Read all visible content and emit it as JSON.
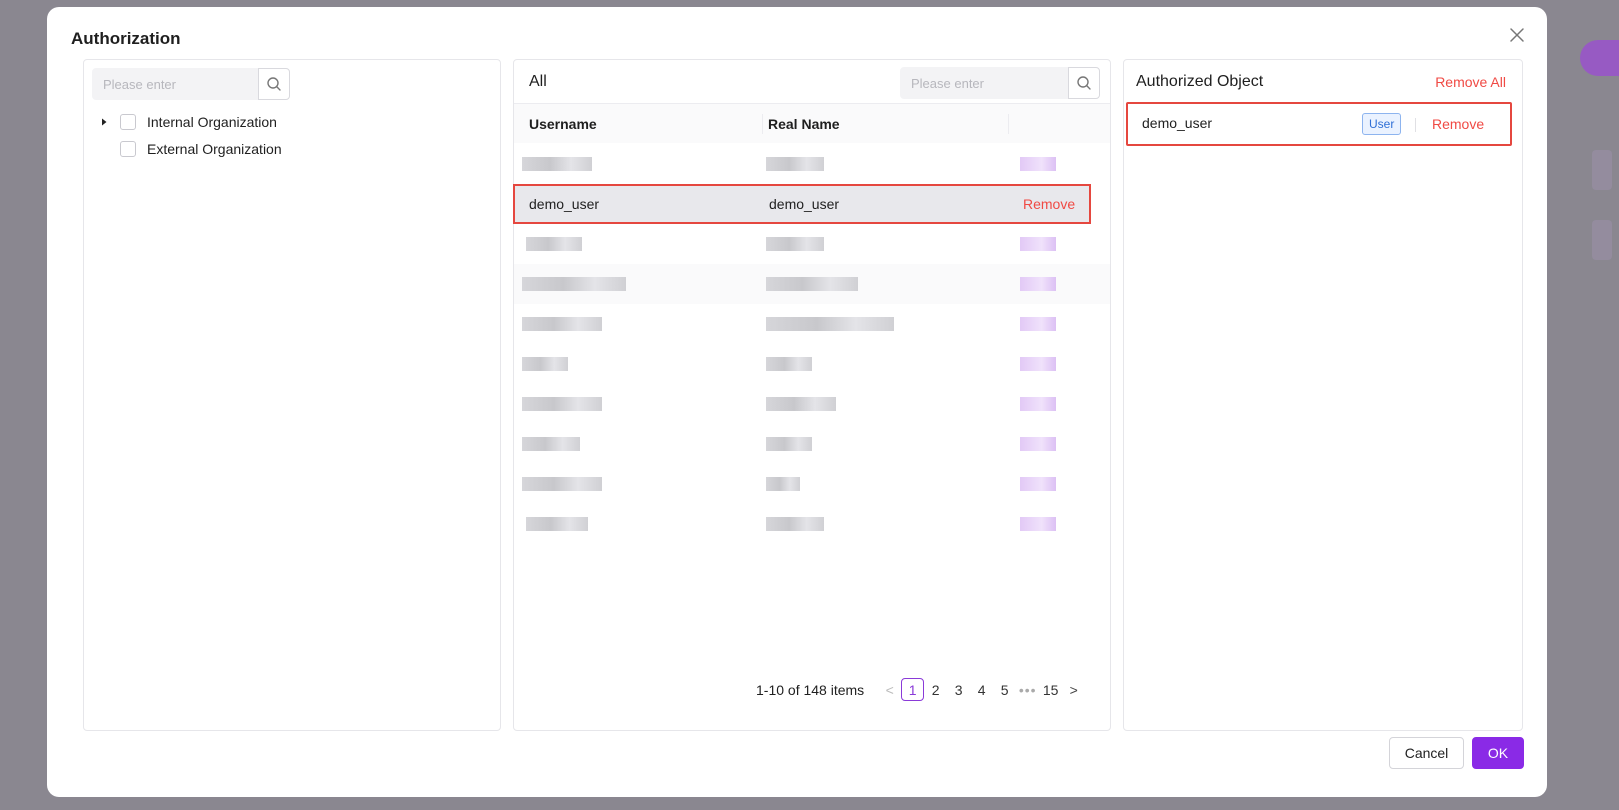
{
  "modal": {
    "title": "Authorization",
    "close_icon": "close-icon"
  },
  "left_panel": {
    "search": {
      "placeholder": "Please enter",
      "icon": "search-icon"
    },
    "tree": [
      {
        "label": "Internal Organization",
        "expandable": true,
        "checked": false
      },
      {
        "label": "External Organization",
        "expandable": false,
        "checked": false
      }
    ]
  },
  "middle_panel": {
    "title": "All",
    "search": {
      "placeholder": "Please enter",
      "icon": "search-icon"
    },
    "columns": [
      "Username",
      "Real Name",
      ""
    ],
    "selected_row": {
      "username": "demo_user",
      "real_name": "demo_user",
      "action": "Remove"
    },
    "pagination": {
      "summary": "1-10 of 148 items",
      "pages": [
        "1",
        "2",
        "3",
        "4",
        "5",
        "•••",
        "15"
      ],
      "current": "1",
      "prev": "<",
      "next": ">"
    }
  },
  "right_panel": {
    "title": "Authorized Object",
    "remove_all": "Remove All",
    "items": [
      {
        "name": "demo_user",
        "tag": "User",
        "action": "Remove"
      }
    ]
  },
  "footer": {
    "cancel": "Cancel",
    "ok": "OK"
  },
  "colors": {
    "accent": "#8a2ae6",
    "danger": "#f04a44",
    "highlight_border": "#e5473f",
    "tag_blue": "#2f6fd6"
  }
}
